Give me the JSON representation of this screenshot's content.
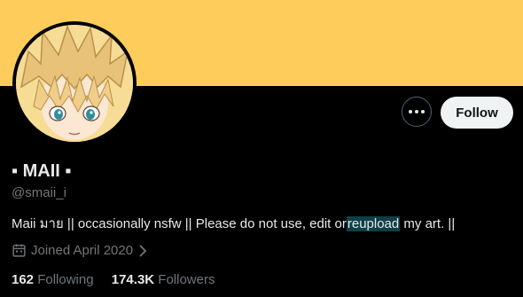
{
  "profile": {
    "display_name": "▪ MAII ▪",
    "handle": "@smaii_i",
    "bio_before": "Maii มาย || occasionally nsfw || Please do not use, edit or",
    "bio_highlight": "reupload",
    "bio_after": "my art. ||",
    "joined": "Joined April 2020",
    "following_count": "162",
    "following_label": "Following",
    "followers_count": "174.3K",
    "followers_label": "Followers"
  },
  "actions": {
    "follow_label": "Follow",
    "more_icon": "more-dots-icon"
  },
  "colors": {
    "banner": "#fdcc5a",
    "background": "#000000",
    "text": "#e7e9ea",
    "muted": "#71767b",
    "selection": "#0f3f47"
  }
}
